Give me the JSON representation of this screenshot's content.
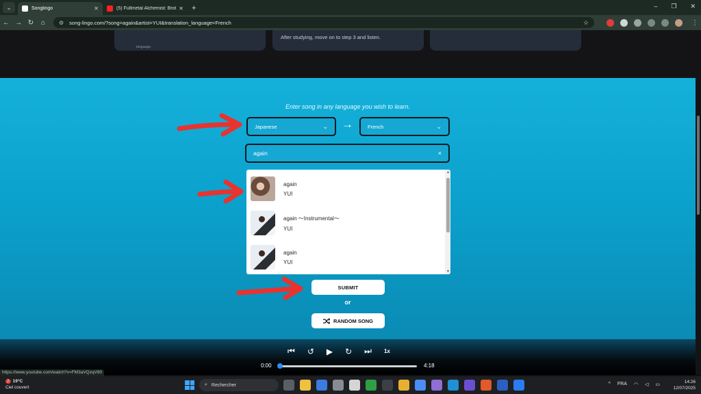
{
  "browser": {
    "tabs": [
      {
        "title": "Songlingo",
        "active": true,
        "favicon_color": "#ffffff"
      },
      {
        "title": "(5) Fullmetal Alchemist: Brothe",
        "active": false,
        "favicon_color": "#ff2020"
      }
    ],
    "new_tab": "+",
    "url": "song-lingo.com/?song=again&artist=YUI&translation_language=French",
    "window_controls": {
      "minimize": "–",
      "maximize": "❐",
      "close": "✕"
    }
  },
  "page": {
    "cards": [
      {
        "text": "",
        "fragment": "language."
      },
      {
        "text": "After studying, move on to step 3 and listen.",
        "fragment": ""
      },
      {
        "text": "",
        "fragment": ""
      }
    ],
    "tagline": "Enter song in any language you wish to learn.",
    "source_language": "Japanese",
    "target_language": "French",
    "swap_arrow": "→",
    "search_query": "again",
    "clear_icon": "×",
    "results": [
      {
        "title": "again",
        "artist": "YUI"
      },
      {
        "title": "again ～Instrumental～",
        "artist": "YUI"
      },
      {
        "title": "again",
        "artist": "YUI"
      }
    ],
    "submit_label": "SUBMIT",
    "or_label": "or",
    "random_label": "RANDOM SONG"
  },
  "player": {
    "current_time": "0:00",
    "duration": "4:18",
    "speed": "1x",
    "progress": 0
  },
  "status_url": "https://www.youtube.com/watch?v=FM3aVQzqV90",
  "taskbar": {
    "weather_badge": "2",
    "weather_temp": "19°C",
    "weather_desc": "Ciel couvert",
    "search_placeholder": "Rechercher",
    "language": "FRA",
    "time": "14:26",
    "date": "12/07/2025"
  },
  "colors": {
    "hero_top": "#15b1db",
    "hero_bottom": "#0a8ab3",
    "annotation_arrow": "#e8332f",
    "progress_knob": "#2f8df1"
  }
}
